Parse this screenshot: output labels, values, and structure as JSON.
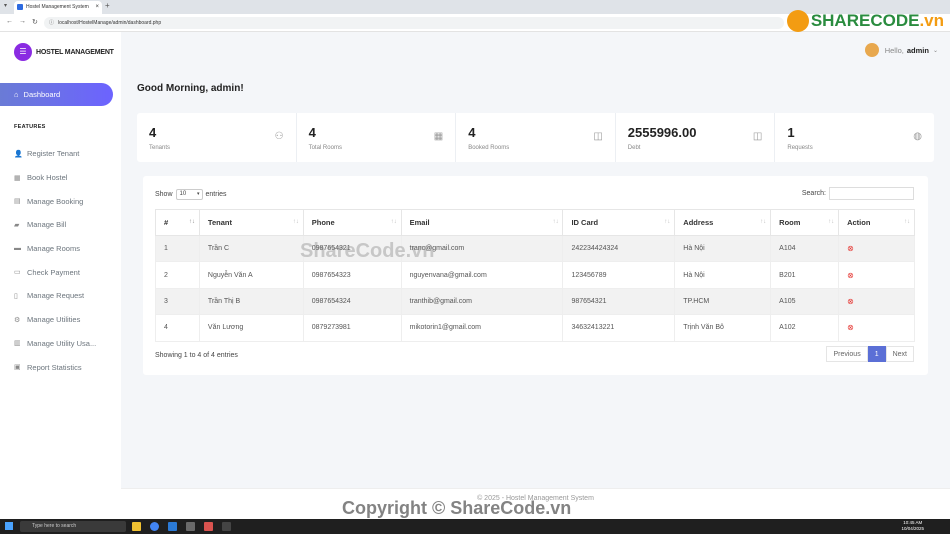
{
  "browser": {
    "tab_title": "Hostel Management System",
    "url": "localhost/HostelManage/admin/dashboard.php"
  },
  "sidebar": {
    "brand": "HOSTEL MANAGEMENT",
    "active_item": "Dashboard",
    "section_label": "FEATURES",
    "items": [
      {
        "label": "Register Tenant",
        "icon": "user-plus-icon"
      },
      {
        "label": "Book Hostel",
        "icon": "building-icon"
      },
      {
        "label": "Manage Booking",
        "icon": "book-icon"
      },
      {
        "label": "Manage Bill",
        "icon": "folder-icon"
      },
      {
        "label": "Manage Rooms",
        "icon": "bed-icon"
      },
      {
        "label": "Check Payment",
        "icon": "card-icon"
      },
      {
        "label": "Manage Request",
        "icon": "file-icon"
      },
      {
        "label": "Manage Utilities",
        "icon": "cogs-icon"
      },
      {
        "label": "Manage Utility Usa...",
        "icon": "chart-icon"
      },
      {
        "label": "Report Statistics",
        "icon": "report-icon"
      }
    ]
  },
  "topbar": {
    "hello": "Hello,",
    "username": "admin"
  },
  "page_title": "Good Morning, admin!",
  "stats": [
    {
      "value": "4",
      "label": "Tenants",
      "icon": "user-add-icon"
    },
    {
      "value": "4",
      "label": "Total Rooms",
      "icon": "grid-icon"
    },
    {
      "value": "4",
      "label": "Booked Rooms",
      "icon": "book-open-icon"
    },
    {
      "value": "2555996.00",
      "label": "Debt",
      "icon": "book-open-icon"
    },
    {
      "value": "1",
      "label": "Requests",
      "icon": "globe-icon"
    }
  ],
  "table_controls": {
    "show": "Show",
    "entries_value": "10",
    "entries": "entries",
    "search_label": "Search:"
  },
  "table": {
    "headers": [
      "#",
      "Tenant",
      "Phone",
      "Email",
      "ID Card",
      "Address",
      "Room",
      "Action"
    ],
    "rows": [
      [
        "1",
        "Trần C",
        "0987654321",
        "tranc@gmail.com",
        "242234424324",
        "Hà Nội",
        "A104"
      ],
      [
        "2",
        "Nguyễn Văn A",
        "0987654323",
        "nguyenvana@gmail.com",
        "123456789",
        "Hà Nội",
        "B201"
      ],
      [
        "3",
        "Trần Thị B",
        "0987654324",
        "tranthib@gmail.com",
        "987654321",
        "TP.HCM",
        "A105"
      ],
      [
        "4",
        "Văn Lương",
        "0879273981",
        "mikotorin1@gmail.com",
        "34632413221",
        "Trịnh Văn Bô",
        "A102"
      ]
    ]
  },
  "table_info": "Showing 1 to 4 of 4 entries",
  "pagination": {
    "previous": "Previous",
    "current": "1",
    "next": "Next"
  },
  "footer": "© 2025 - Hostel Management System",
  "taskbar": {
    "search_placeholder": "Type here to search",
    "time": "10:45 AM",
    "date": "10/04/2025"
  },
  "watermarks": {
    "top": "SHARECODE",
    "top_suffix": ".vn",
    "center": "ShareCode.vn",
    "bottom": "Copyright © ShareCode.vn"
  }
}
